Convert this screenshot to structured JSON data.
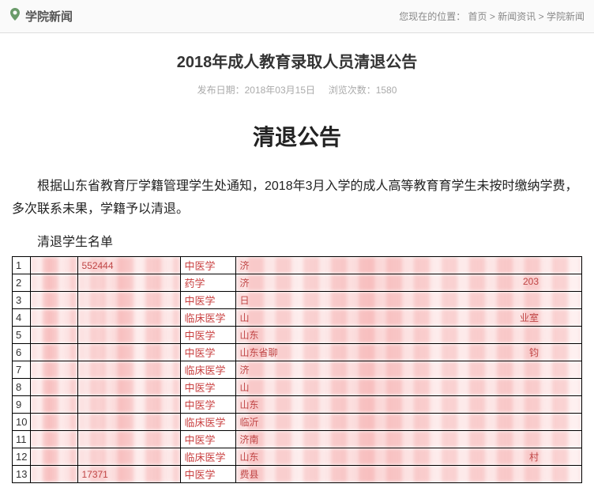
{
  "header": {
    "section_title": "学院新闻",
    "breadcrumb_prefix": "您现在的位置：",
    "crumb_home": "首页",
    "crumb_news": "新闻资讯",
    "crumb_current": "学院新闻",
    "separator": ">"
  },
  "article": {
    "title": "2018年成人教育录取人员清退公告",
    "meta_date_label": "发布日期：",
    "meta_date": "2018年03月15日",
    "meta_views_label": "浏览次数：",
    "meta_views": "1580"
  },
  "notice": {
    "heading": "清退公告",
    "body": "根据山东省教育厅学籍管理学生处通知，2018年3月入学的成人高等教育育学生未按时缴纳学费，多次联系未果，学籍予以清退。",
    "list_heading": "清退学生名单"
  },
  "table": {
    "rows": [
      {
        "num": "1",
        "major": "中医学",
        "frag2": "552444",
        "frag3": "济"
      },
      {
        "num": "2",
        "major": "药学",
        "frag3": "济",
        "frag_extra": "203"
      },
      {
        "num": "3",
        "major": "中医学",
        "frag3": "日"
      },
      {
        "num": "4",
        "major": "临床医学",
        "frag3": "山",
        "frag_extra": "业室"
      },
      {
        "num": "5",
        "major": "中医学",
        "frag3": "山东"
      },
      {
        "num": "6",
        "major": "中医学",
        "frag3": "山东省聊",
        "frag_extra": "钧"
      },
      {
        "num": "7",
        "major": "临床医学",
        "frag3": "济"
      },
      {
        "num": "8",
        "major": "中医学",
        "frag3": "山"
      },
      {
        "num": "9",
        "major": "中医学",
        "frag3": "山东"
      },
      {
        "num": "10",
        "major": "临床医学",
        "frag3": "临沂"
      },
      {
        "num": "11",
        "major": "中医学",
        "frag3": "济南"
      },
      {
        "num": "12",
        "major": "临床医学",
        "frag3": "山东",
        "frag_extra": "村"
      },
      {
        "num": "13",
        "major": "中医学",
        "frag2": "17371",
        "frag3": "费县"
      }
    ]
  }
}
